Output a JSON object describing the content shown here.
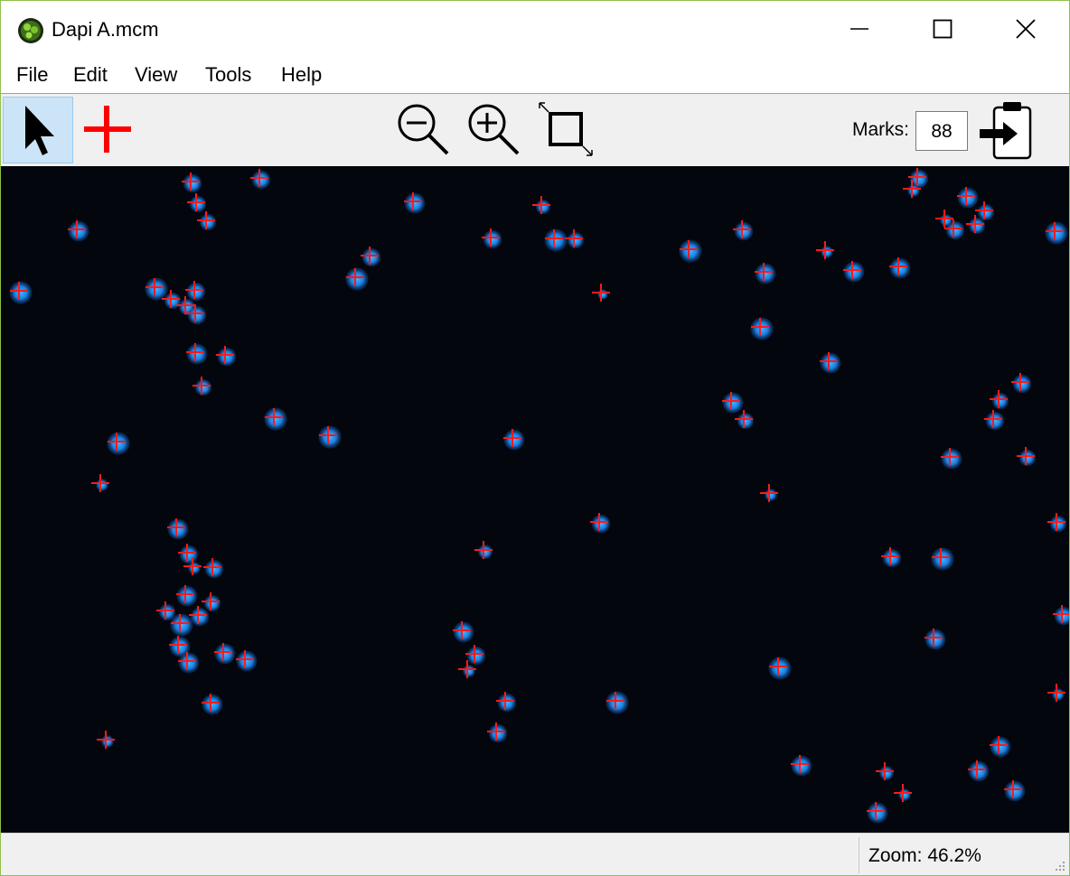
{
  "window": {
    "title": "Dapi A.mcm"
  },
  "menu": {
    "items": [
      "File",
      "Edit",
      "View",
      "Tools",
      "Help"
    ]
  },
  "toolbar": {
    "marks_label": "Marks:",
    "marks_value": "88"
  },
  "status": {
    "zoom": "Zoom: 46.2%"
  },
  "colors": {
    "cell": "#1a7fe0",
    "mark": "#ff1a1a",
    "canvas": "#03060d",
    "selected_tool": "#cce4f7"
  },
  "icons": [
    "app-icon",
    "minimize-icon",
    "maximize-icon",
    "close-icon",
    "pointer-tool-icon",
    "mark-tool-icon",
    "zoom-out-icon",
    "zoom-in-icon",
    "fit-to-window-icon",
    "export-clipboard-icon",
    "resize-grip-icon"
  ]
}
